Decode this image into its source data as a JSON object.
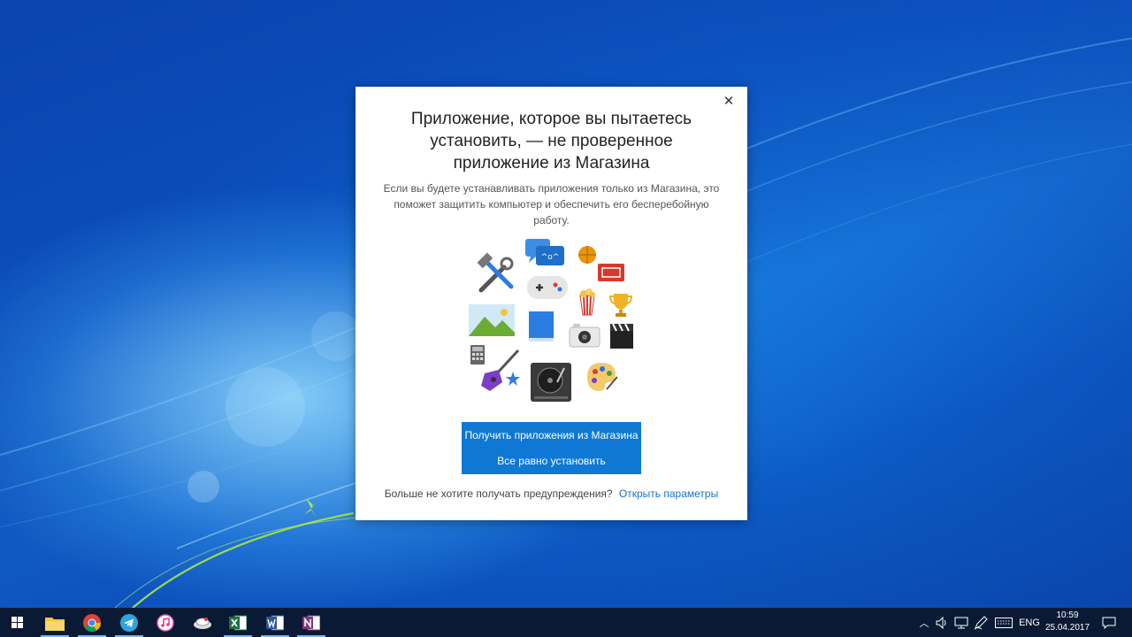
{
  "dialog": {
    "close_glyph": "✕",
    "title_lines": [
      "Приложение, которое вы пытаетесь",
      "установить, — не проверенное",
      "приложение из Магазина"
    ],
    "description_lines": [
      "Если вы будете устанавливать приложения только из Магазина, это",
      "поможет защитить компьютер и обеспечить его бесперебойную",
      "работу."
    ],
    "primary_button": "Получить приложения из Магазина",
    "secondary_button": "Все равно установить",
    "footer_text": "Больше не хотите получать предупреждения?",
    "footer_link": "Открыть параметры",
    "accent_color": "#0f78d4",
    "link_color": "#1a73c9"
  },
  "illustration_icons": [
    "tools-icon",
    "chat-icon",
    "basketball-icon",
    "ticket-icon",
    "gamepad-icon",
    "popcorn-icon",
    "trophy-icon",
    "landscape-image-icon",
    "book-icon",
    "camera-icon",
    "clapperboard-icon",
    "calculator-icon",
    "guitar-icon",
    "star-icon",
    "turntable-icon",
    "palette-icon"
  ],
  "chat_bubble_text": "^o^",
  "taskbar": {
    "apps": [
      "file-explorer-icon",
      "chrome-icon",
      "telegram-icon",
      "itunes-icon",
      "app-icon",
      "excel-icon",
      "word-icon",
      "onenote-icon"
    ],
    "tray": {
      "language": "ENG",
      "time": "10:59",
      "date": "25.04.2017"
    },
    "color": "#0b1a34"
  }
}
